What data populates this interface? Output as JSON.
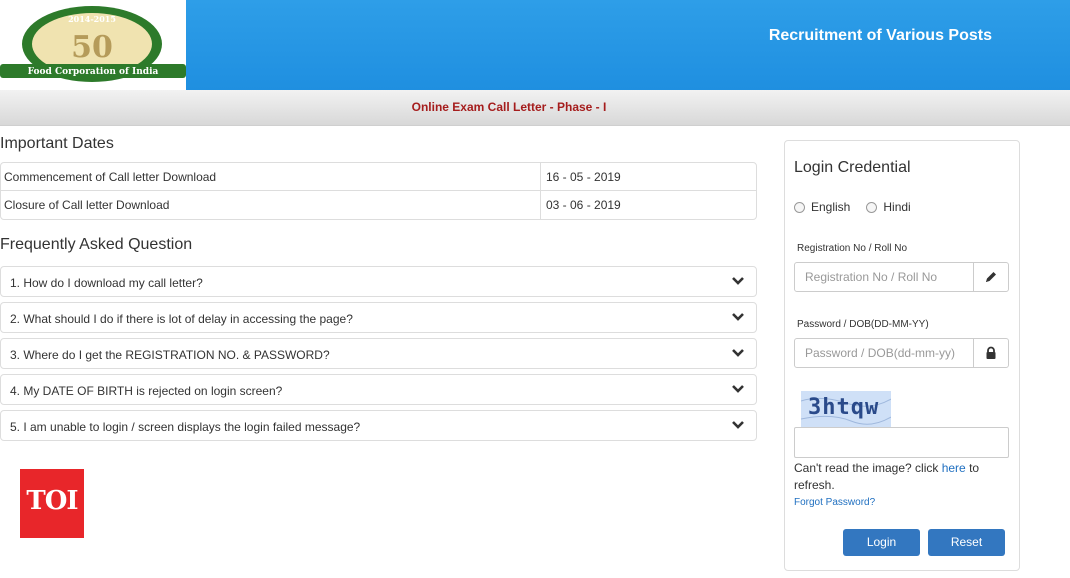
{
  "header": {
    "title": "Recruitment of Various Posts",
    "logo": {
      "years": "2014-2015",
      "org_name": "Food Corporation of India",
      "emblem_number": "50"
    }
  },
  "subheader": {
    "title": "Online Exam Call Letter - Phase - I"
  },
  "important_dates": {
    "title": "Important Dates",
    "rows": [
      {
        "label": "Commencement of Call letter Download",
        "value": "16 - 05 - 2019"
      },
      {
        "label": "Closure of Call letter Download",
        "value": "03 - 06 - 2019"
      }
    ]
  },
  "faq": {
    "title": "Frequently Asked Question",
    "items": [
      "1. How do I download my call letter?",
      "2. What should I do if there is lot of delay in accessing the page?",
      "3. Where do I get the REGISTRATION NO. & PASSWORD?",
      "4. My DATE OF BIRTH is rejected on login screen?",
      "5. I am unable to login / screen displays the login failed message?"
    ]
  },
  "watermark": {
    "text": "TOI"
  },
  "login": {
    "title": "Login Credential",
    "languages": [
      "English",
      "Hindi"
    ],
    "registration_label": "Registration No / Roll No",
    "registration_placeholder": "Registration No / Roll No",
    "password_label": "Password / DOB(DD-MM-YY)",
    "password_placeholder": "Password / DOB(dd-mm-yy)",
    "captcha_text": "3htqw",
    "refresh_prefix": "Can't read the image? click ",
    "refresh_link": "here",
    "refresh_suffix": " to refresh.",
    "forgot_password": "Forgot Password?",
    "login_button": "Login",
    "reset_button": "Reset"
  },
  "icons": {
    "edit": "pencil-icon",
    "password": "lock-icon",
    "faq_toggle": "chevron-down-icon"
  },
  "colors": {
    "header_blue": "#1f8fe0",
    "subheader_text": "#a51d1d",
    "button": "#3377c0",
    "link": "#1f6fc0",
    "toi_red": "#e8262a"
  }
}
